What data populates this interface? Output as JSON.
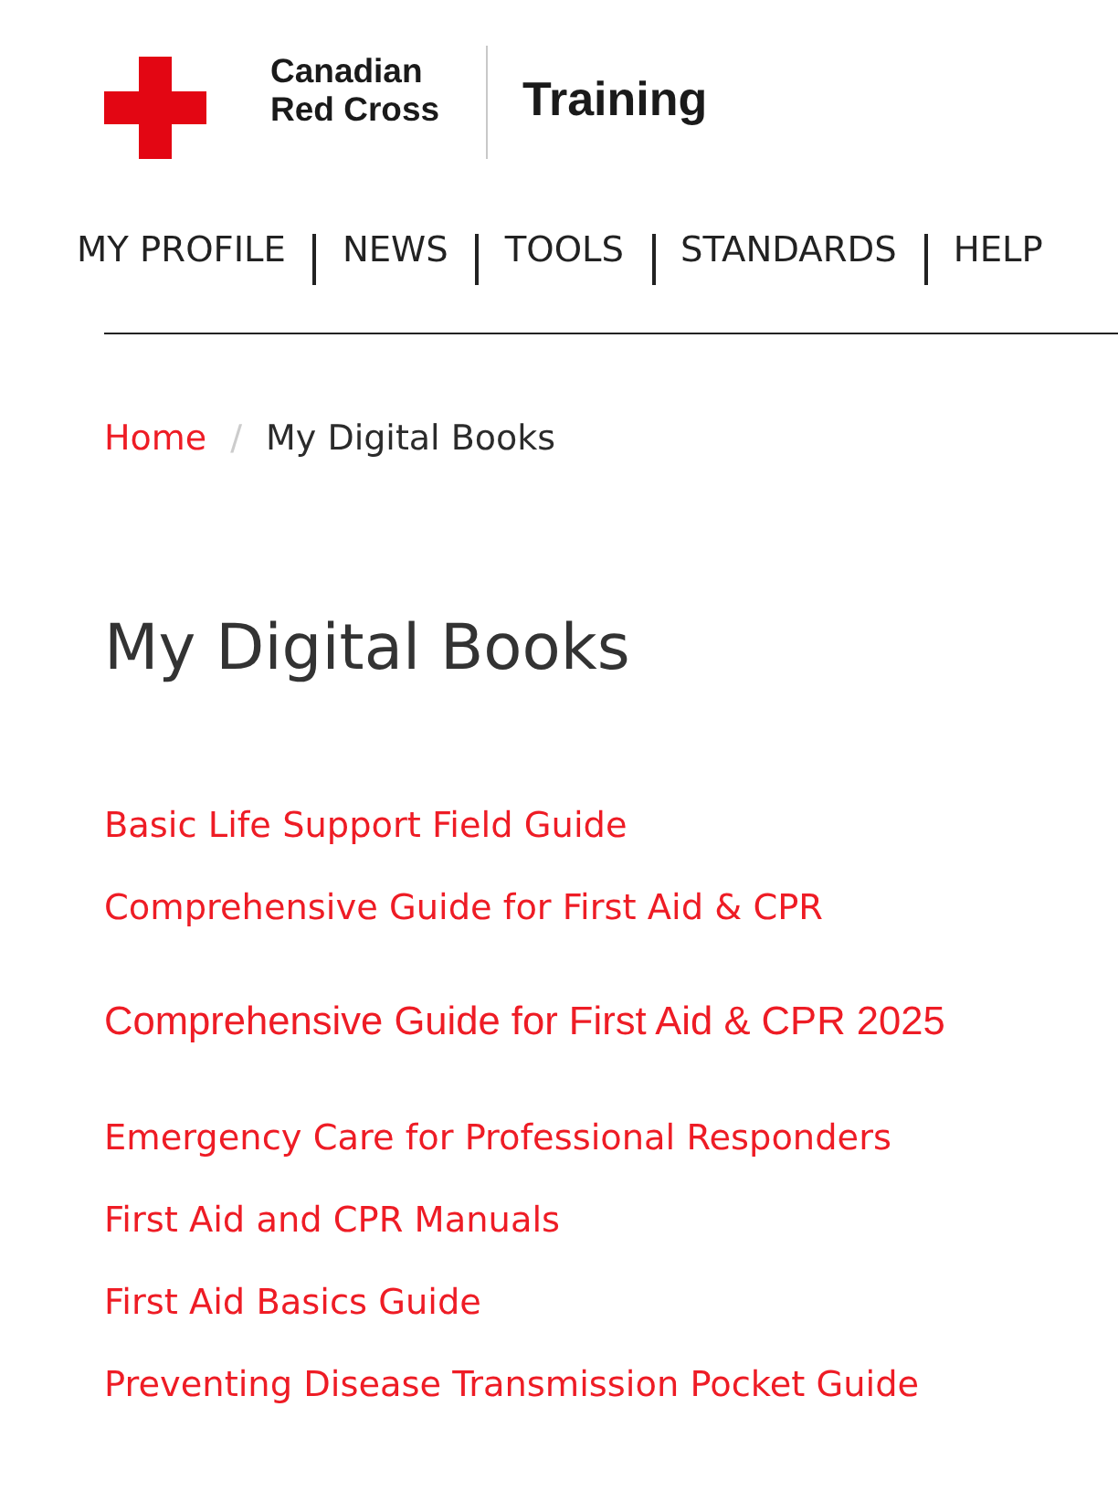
{
  "header": {
    "brand": "Canadian Red Cross",
    "product": "Training"
  },
  "nav": [
    "MY PROFILE",
    "NEWS",
    "TOOLS",
    "STANDARDS",
    "HELP"
  ],
  "breadcrumb": {
    "separator": "/",
    "items": [
      {
        "label": "Home",
        "kind": "link"
      },
      {
        "label": "My Digital Books",
        "kind": "current"
      }
    ]
  },
  "page_title": "My Digital Books",
  "books": [
    {
      "title": "Basic Life Support Field Guide",
      "kind": "standard"
    },
    {
      "title": "Comprehensive Guide for First Aid & CPR",
      "kind": "standard"
    },
    {
      "title": "Comprehensive Guide for First Aid & CPR 2025",
      "kind": "alternate"
    },
    {
      "title": "Emergency Care for Professional Responders",
      "kind": "standard"
    },
    {
      "title": "First Aid and CPR Manuals",
      "kind": "standard"
    },
    {
      "title": "First Aid Basics Guide",
      "kind": "standard"
    },
    {
      "title": "Preventing Disease Transmission Pocket Guide",
      "kind": "standard"
    }
  ]
}
